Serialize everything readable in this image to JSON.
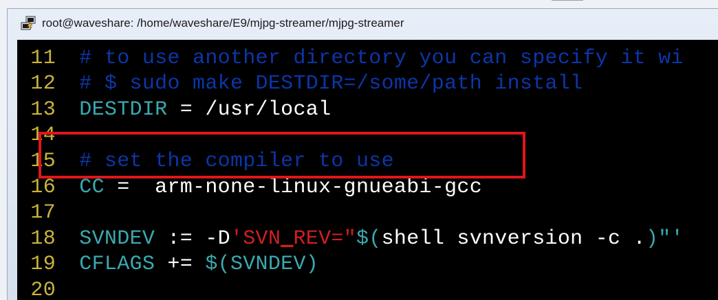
{
  "window": {
    "title": "root@waveshare: /home/waveshare/E9/mjpg-streamer/mjpg-streamer",
    "icon": "putty-terminal-icon"
  },
  "editor": {
    "lines": [
      {
        "num": "11",
        "tokens": [
          {
            "text": " # to use another directory you can specify it wi",
            "cls": "cm"
          }
        ]
      },
      {
        "num": "12",
        "tokens": [
          {
            "text": " # $ sudo make DESTDIR=/some/path install",
            "cls": "cm"
          }
        ]
      },
      {
        "num": "13",
        "tokens": [
          {
            "text": " DESTDIR",
            "cls": "var"
          },
          {
            "text": " = /usr/local",
            "cls": "plain"
          }
        ]
      },
      {
        "num": "14",
        "tokens": []
      },
      {
        "num": "15",
        "tokens": [
          {
            "text": " # set the compiler to use",
            "cls": "cm"
          }
        ]
      },
      {
        "num": "16",
        "tokens": [
          {
            "text": " CC",
            "cls": "var"
          },
          {
            "text": " =  arm-none-linux-gnueabi-gcc",
            "cls": "plain"
          }
        ]
      },
      {
        "num": "17",
        "tokens": []
      },
      {
        "num": "18",
        "tokens": [
          {
            "text": " SVNDEV",
            "cls": "var"
          },
          {
            "text": " := -D",
            "cls": "plain"
          },
          {
            "text": "'SVN",
            "cls": "str"
          },
          {
            "text": "_",
            "cls": "str ul"
          },
          {
            "text": "REV=\"",
            "cls": "str"
          },
          {
            "text": "$(",
            "cls": "var"
          },
          {
            "text": "shell svnversion -c .",
            "cls": "plain"
          },
          {
            "text": ")\"'",
            "cls": "var"
          }
        ]
      },
      {
        "num": "19",
        "tokens": [
          {
            "text": " CFLAGS",
            "cls": "var"
          },
          {
            "text": " += ",
            "cls": "plain"
          },
          {
            "text": "$(SVNDEV)",
            "cls": "var"
          }
        ]
      },
      {
        "num": "20",
        "tokens": []
      }
    ]
  },
  "colors": {
    "background": "#000000",
    "line_number": "#c9b53a",
    "comment": "#0c36a8",
    "variable": "#3aa9b0",
    "plain_text": "#ffffff",
    "string": "#d01f1f",
    "highlight_border": "#e0161b"
  }
}
